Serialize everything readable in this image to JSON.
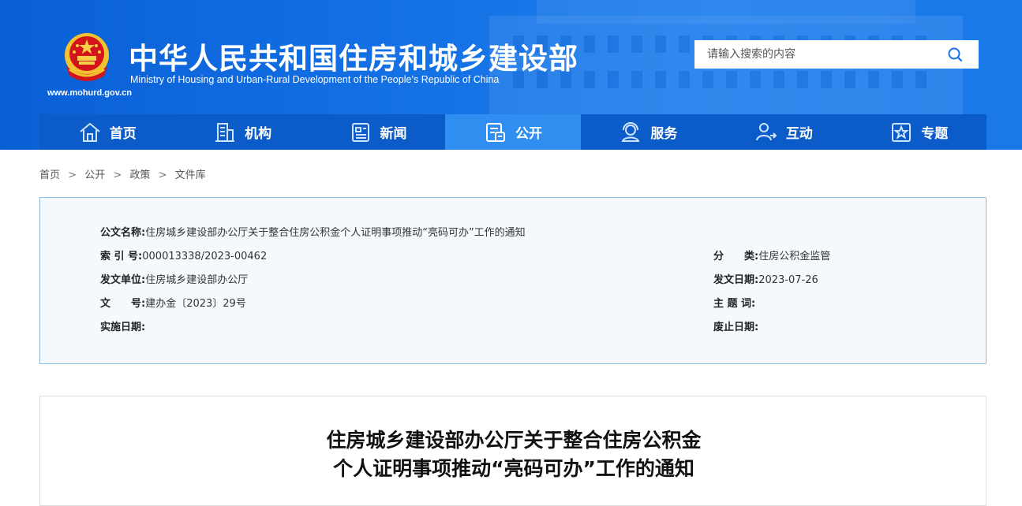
{
  "header": {
    "title": "中华人民共和国住房和城乡建设部",
    "subtitle": "Ministry of Housing and Urban-Rural Development of the People’s Republic of China",
    "url": "www.mohurd.gov.cn",
    "emblem_icon": "national-emblem-icon"
  },
  "search": {
    "placeholder": "请输入搜索的内容",
    "value": "",
    "icon": "search-icon"
  },
  "nav": {
    "items": [
      {
        "label": "首页",
        "icon": "home-icon"
      },
      {
        "label": "机构",
        "icon": "building-icon"
      },
      {
        "label": "新闻",
        "icon": "news-icon"
      },
      {
        "label": "公开",
        "icon": "document-icon",
        "active": true
      },
      {
        "label": "服务",
        "icon": "service-icon"
      },
      {
        "label": "互动",
        "icon": "interaction-icon"
      },
      {
        "label": "专题",
        "icon": "topic-icon"
      }
    ]
  },
  "breadcrumb": [
    "首页",
    "公开",
    "政策",
    "文件库"
  ],
  "breadcrumb_separator": ">",
  "info": {
    "doc_name_label": "公文名称:",
    "doc_name": "住房城乡建设部办公厅关于整合住房公积金个人证明事项推动“亮码可办”工作的通知",
    "index_label": "索 引 号:",
    "index": "000013338/2023-00462",
    "category_label": "分　　类:",
    "category": "住房公积金监管",
    "issuer_label": "发文单位:",
    "issuer": "住房城乡建设部办公厅",
    "date_label": "发文日期:",
    "date": "2023-07-26",
    "docno_label": "文　　号:",
    "docno": "建办金〔2023〕29号",
    "subject_label": "主 题 词:",
    "subject": "",
    "effective_label": "实施日期:",
    "effective": "",
    "expire_label": "废止日期:",
    "expire": ""
  },
  "content": {
    "title_line1": "住房城乡建设部办公厅关于整合住房公积金",
    "title_line2": "个人证明事项推动“亮码可办”工作的通知"
  },
  "colors": {
    "header_blue": "#1573e6",
    "nav_blue": "#0b5cc8",
    "nav_active": "#2f8ef0",
    "info_bg": "#f4f9fd",
    "info_border": "#8fbde0"
  }
}
